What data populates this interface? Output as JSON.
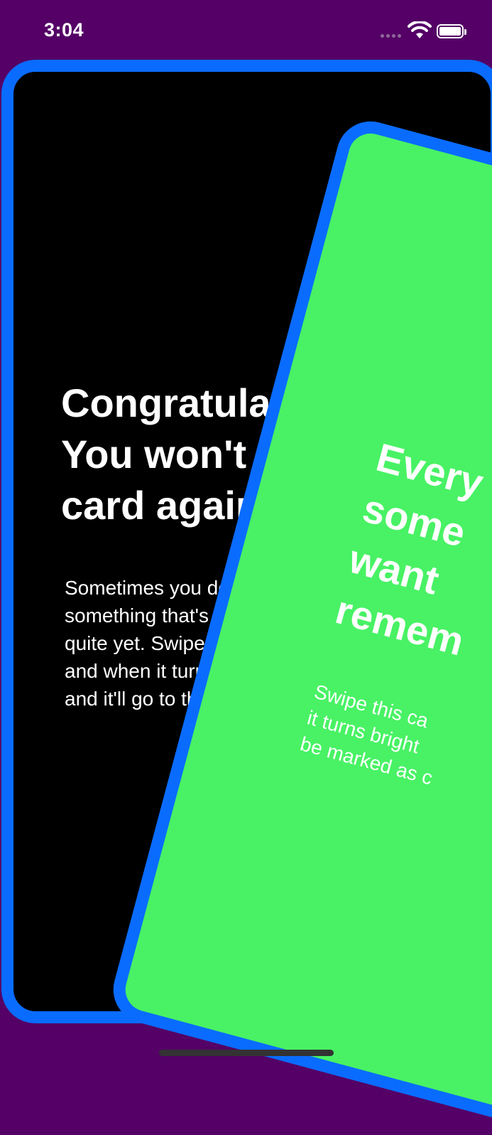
{
  "status_bar": {
    "time": "3:04",
    "wifi_icon": "wifi-icon",
    "battery_icon": "battery-icon",
    "signal_icon": "cellular-signal-icon"
  },
  "colors": {
    "background": "#540066",
    "card_border": "#0a6cff",
    "back_card": "#000000",
    "front_card": "#48f264",
    "text": "#ffffff"
  },
  "back_card": {
    "title_lines": [
      "Congratulations! ",
      "You won't see this",
      "card again!"
    ],
    "body_lines": [
      "Sometimes you don't want to",
      "something that's on your board",
      "quite yet. Swipe this one to the",
      "and when it turns bright blue",
      "and it'll go to the bottom"
    ]
  },
  "front_card": {
    "title_lines": [
      "Every",
      "some",
      "want",
      "remem"
    ],
    "body_lines": [
      "Swipe this ca",
      "it turns bright",
      "be marked as c"
    ]
  }
}
